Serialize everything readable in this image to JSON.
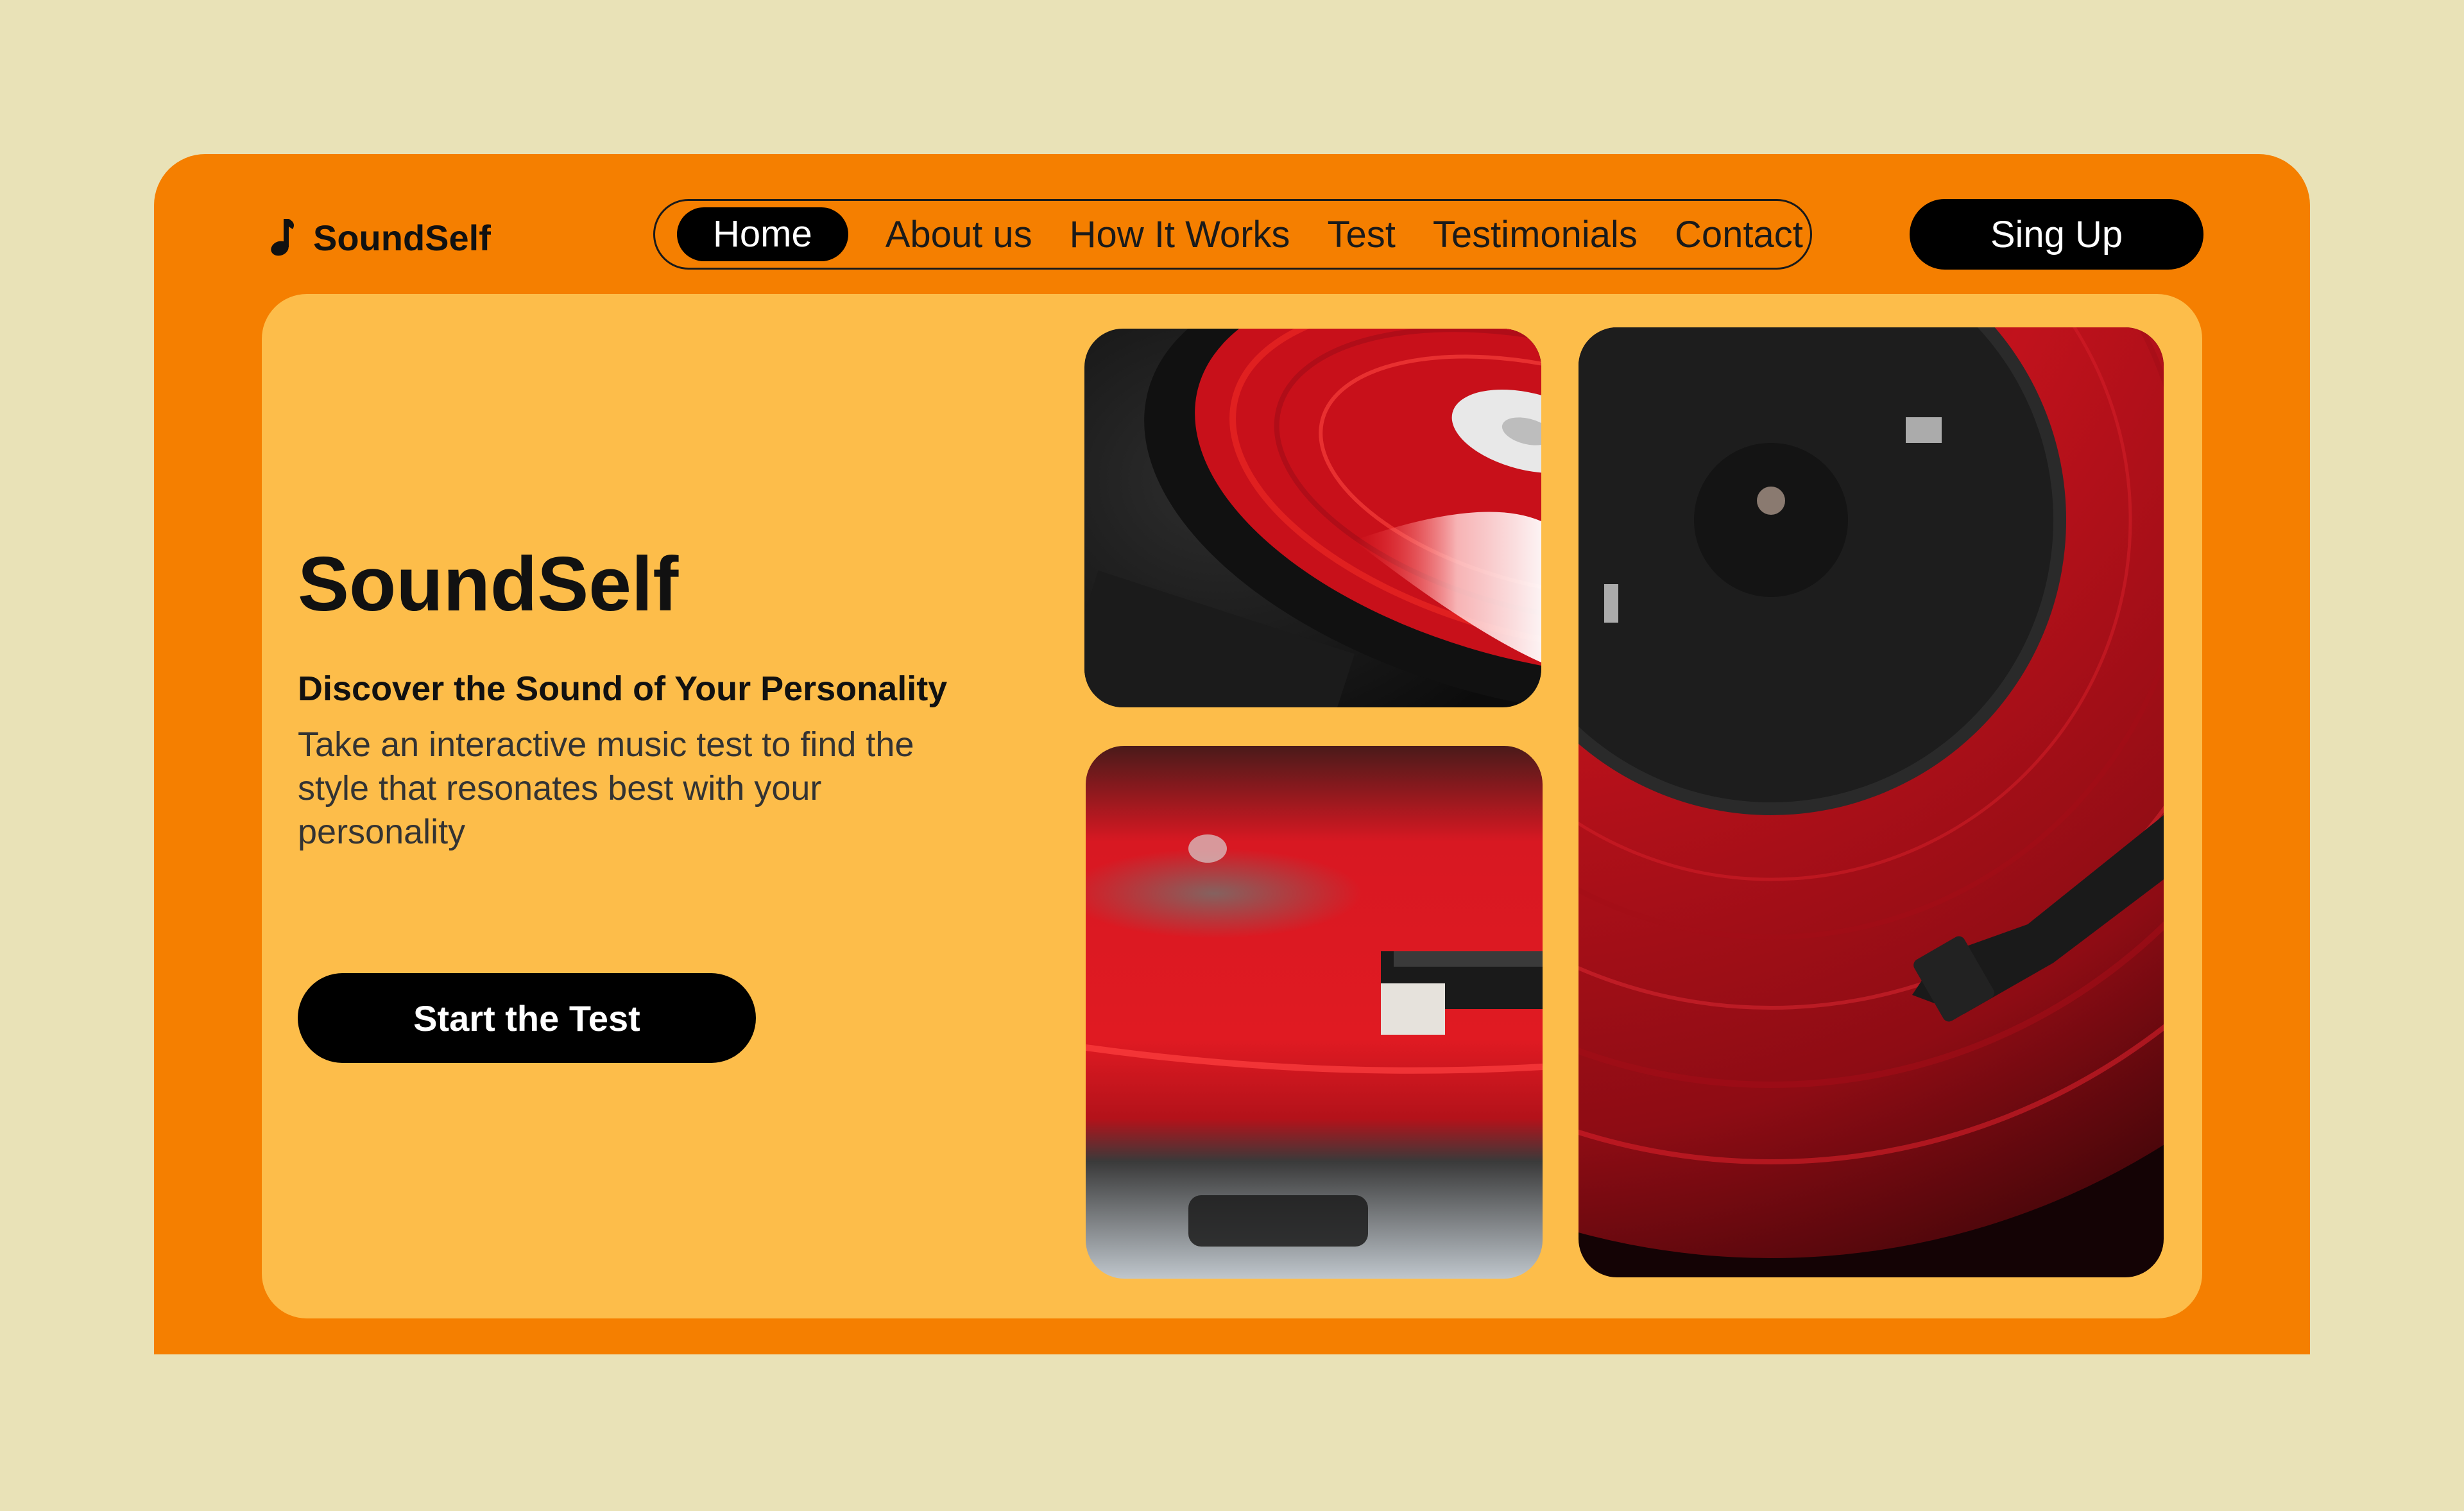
{
  "brand": {
    "name": "SoundSelf",
    "logo_icon": "music-note-icon"
  },
  "nav": {
    "items": [
      {
        "label": "Home",
        "active": true
      },
      {
        "label": "About us",
        "active": false
      },
      {
        "label": "How It Works",
        "active": false
      },
      {
        "label": "Test",
        "active": false
      },
      {
        "label": "Testimonials",
        "active": false
      },
      {
        "label": "Contact",
        "active": false
      }
    ],
    "signup_label": "Sing Up"
  },
  "hero": {
    "title": "SoundSelf",
    "subtitle": "Discover the Sound of Your Personality",
    "description": "Take an interactive music test to find the style that resonates best with your personality",
    "cta_label": "Start the Test"
  },
  "colors": {
    "page_background": "#e9e2b7",
    "frame": "#f57f00",
    "panel": "#fdbd4a",
    "button": "#000000",
    "vinyl_red": "#d8101e"
  },
  "gallery": [
    {
      "subject": "red vinyl record on turntable, close-up"
    },
    {
      "subject": "turntable needle on red vinyl record"
    },
    {
      "subject": "red vinyl record with black center label"
    }
  ]
}
